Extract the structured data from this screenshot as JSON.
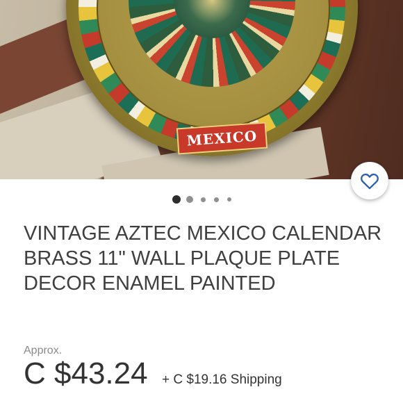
{
  "listing": {
    "image_text": "MEXICO",
    "title": "VINTAGE AZTEC MEXICO CALENDAR BRASS 11\" WALL PLAQUE PLATE DECOR ENAMEL PAINTED",
    "price_prefix": "Approx.",
    "price": "C $43.24",
    "shipping": "+ C $19.16 Shipping"
  },
  "gallery": {
    "total_images": 5,
    "active_index": 0
  },
  "favorite": {
    "icon": "heart-outline-icon",
    "color": "#2f5fb3"
  }
}
